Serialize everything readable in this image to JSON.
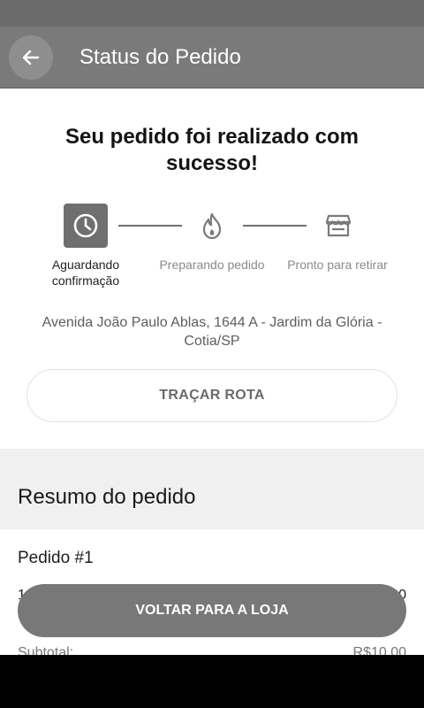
{
  "header": {
    "title": "Status do Pedido",
    "back_icon": "arrow-left-icon"
  },
  "status": {
    "message": "Seu pedido foi realizado com sucesso!",
    "steps": [
      {
        "label": "Aguardando confirmação",
        "icon": "clock-icon",
        "active": true
      },
      {
        "label": "Preparando pedido",
        "icon": "flame-icon",
        "active": false
      },
      {
        "label": "Pronto para retirar",
        "icon": "store-icon",
        "active": false
      }
    ]
  },
  "address": "Avenida João Paulo Ablas, 1644  A - Jardim da Glória - Cotia/SP",
  "route_button": "TRAÇAR ROTA",
  "summary": {
    "title": "Resumo do pedido",
    "order_number": "Pedido #1",
    "item_qty": "1",
    "item_price": "0",
    "subtotal_label": "Subtotal:",
    "subtotal_value": "R$10,00"
  },
  "back_to_store_button": "VOLTAR PARA A LOJA",
  "colors": {
    "app_bar": "#7a7a7a",
    "accent": "#6f6f6f",
    "button": "#787878"
  }
}
